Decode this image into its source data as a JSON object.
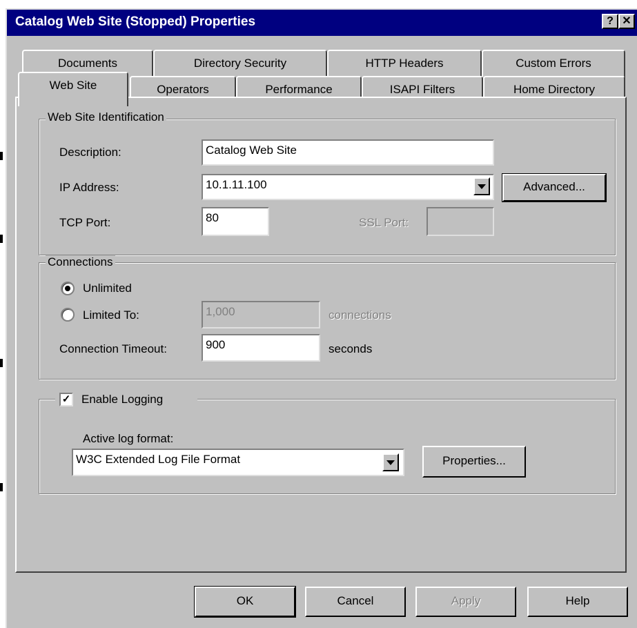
{
  "window": {
    "title": "Catalog Web Site (Stopped) Properties",
    "help_button": "?",
    "close_button": "✕"
  },
  "tabs_back": [
    "Documents",
    "Directory Security",
    "HTTP Headers",
    "Custom Errors"
  ],
  "tabs_front": [
    "Web Site",
    "Operators",
    "Performance",
    "ISAPI Filters",
    "Home Directory"
  ],
  "active_tab": "Web Site",
  "identification": {
    "legend": "Web Site Identification",
    "description_label": "Description:",
    "description_value": "Catalog Web Site",
    "ip_label": "IP Address:",
    "ip_value": "10.1.11.100",
    "advanced_button": "Advanced...",
    "tcp_label": "TCP Port:",
    "tcp_value": "80",
    "ssl_label": "SSL Port:",
    "ssl_value": ""
  },
  "connections": {
    "legend": "Connections",
    "unlimited_label": "Unlimited",
    "unlimited_selected": true,
    "limited_label": "Limited To:",
    "limited_value": "1,000",
    "limited_units": "connections",
    "timeout_label": "Connection Timeout:",
    "timeout_value": "900",
    "timeout_units": "seconds"
  },
  "logging": {
    "enable_label": "Enable Logging",
    "enabled": true,
    "format_label": "Active log format:",
    "format_value": "W3C Extended Log File Format",
    "properties_button": "Properties..."
  },
  "buttons": {
    "ok": "OK",
    "cancel": "Cancel",
    "apply": "Apply",
    "help": "Help"
  },
  "colors": {
    "titlebar": "#000080",
    "face": "#c0c0c0",
    "disabled_text": "#808080"
  }
}
